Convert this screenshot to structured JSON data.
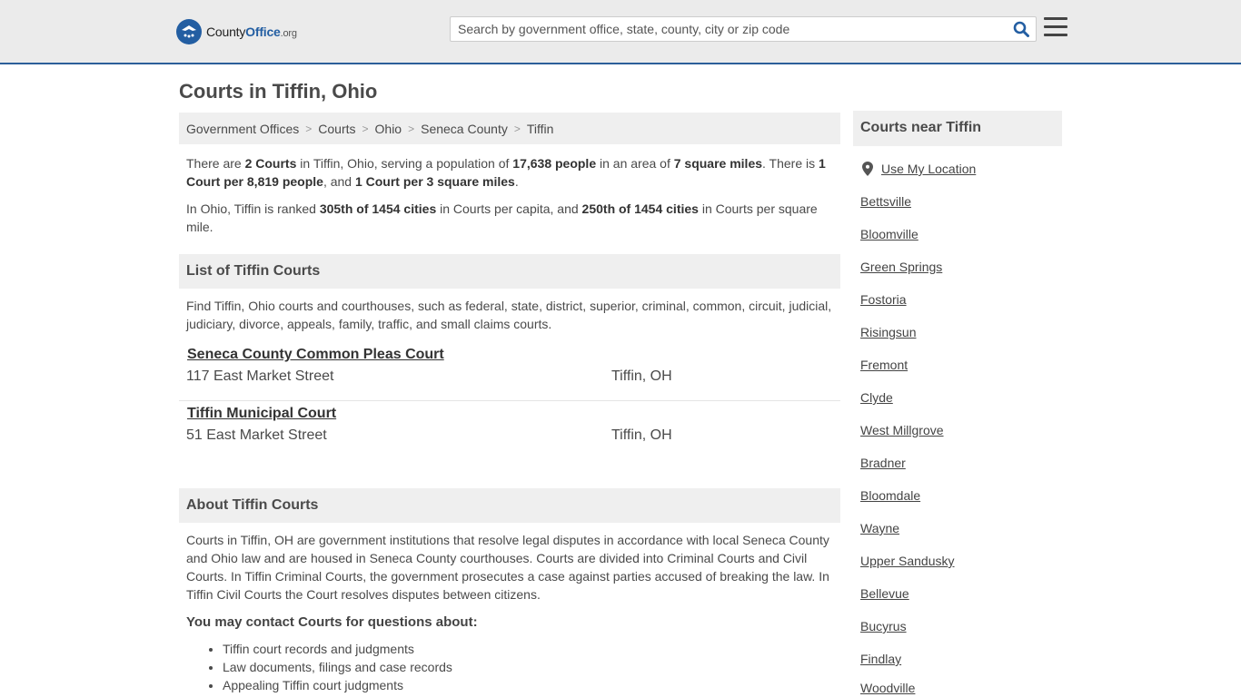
{
  "header": {
    "logo_text_prefix": "County",
    "logo_text_bold": "Office",
    "logo_text_tld": ".org",
    "search_placeholder": "Search by government office, state, county, city or zip code"
  },
  "page_title": "Courts in Tiffin, Ohio",
  "breadcrumb": [
    "Government Offices",
    "Courts",
    "Ohio",
    "Seneca County",
    "Tiffin"
  ],
  "intro": {
    "p1": {
      "t1": "There are ",
      "b1": "2 Courts",
      "t2": " in Tiffin, Ohio, serving a population of ",
      "b2": "17,638 people",
      "t3": " in an area of ",
      "b3": "7 square miles",
      "t4": ". There is ",
      "b4": "1 Court per 8,819 people",
      "t5": ", and ",
      "b5": "1 Court per 3 square miles",
      "t6": "."
    },
    "p2": {
      "t1": "In Ohio, Tiffin is ranked ",
      "b1": "305th of 1454 cities",
      "t2": " in Courts per capita, and ",
      "b2": "250th of 1454 cities",
      "t3": " in Courts per square mile."
    }
  },
  "list_section": {
    "heading": "List of Tiffin Courts",
    "description": "Find Tiffin, Ohio courts and courthouses, such as federal, state, district, superior, criminal, common, circuit, judicial, judiciary, divorce, appeals, family, traffic, and small claims courts.",
    "items": [
      {
        "name": "Seneca County Common Pleas Court",
        "address": "117 East Market Street",
        "city": "Tiffin, OH"
      },
      {
        "name": "Tiffin Municipal Court",
        "address": "51 East Market Street",
        "city": "Tiffin, OH"
      }
    ]
  },
  "about_section": {
    "heading": "About Tiffin Courts",
    "text": "Courts in Tiffin, OH are government institutions that resolve legal disputes in accordance with local Seneca County and Ohio law and are housed in Seneca County courthouses. Courts are divided into Criminal Courts and Civil Courts. In Tiffin Criminal Courts, the government prosecutes a case against parties accused of breaking the law. In Tiffin Civil Courts the Court resolves disputes between citizens.",
    "contact_heading": "You may contact Courts for questions about:",
    "contact_items": [
      "Tiffin court records and judgments",
      "Law documents, filings and case records",
      "Appealing Tiffin court judgments"
    ]
  },
  "sidebar": {
    "heading": "Courts near Tiffin",
    "use_location": "Use My Location",
    "cities": [
      "Bettsville",
      "Bloomville",
      "Green Springs",
      "Fostoria",
      "Risingsun",
      "Fremont",
      "Clyde",
      "West Millgrove",
      "Bradner",
      "Bloomdale",
      "Wayne",
      "Upper Sandusky",
      "Bellevue",
      "Bucyrus",
      "Findlay",
      "Woodville"
    ]
  },
  "colors": {
    "brand_blue": "#235ea2",
    "header_bg": "#ebebeb",
    "panel_bg": "#efefef",
    "text": "#4a4a4a"
  }
}
